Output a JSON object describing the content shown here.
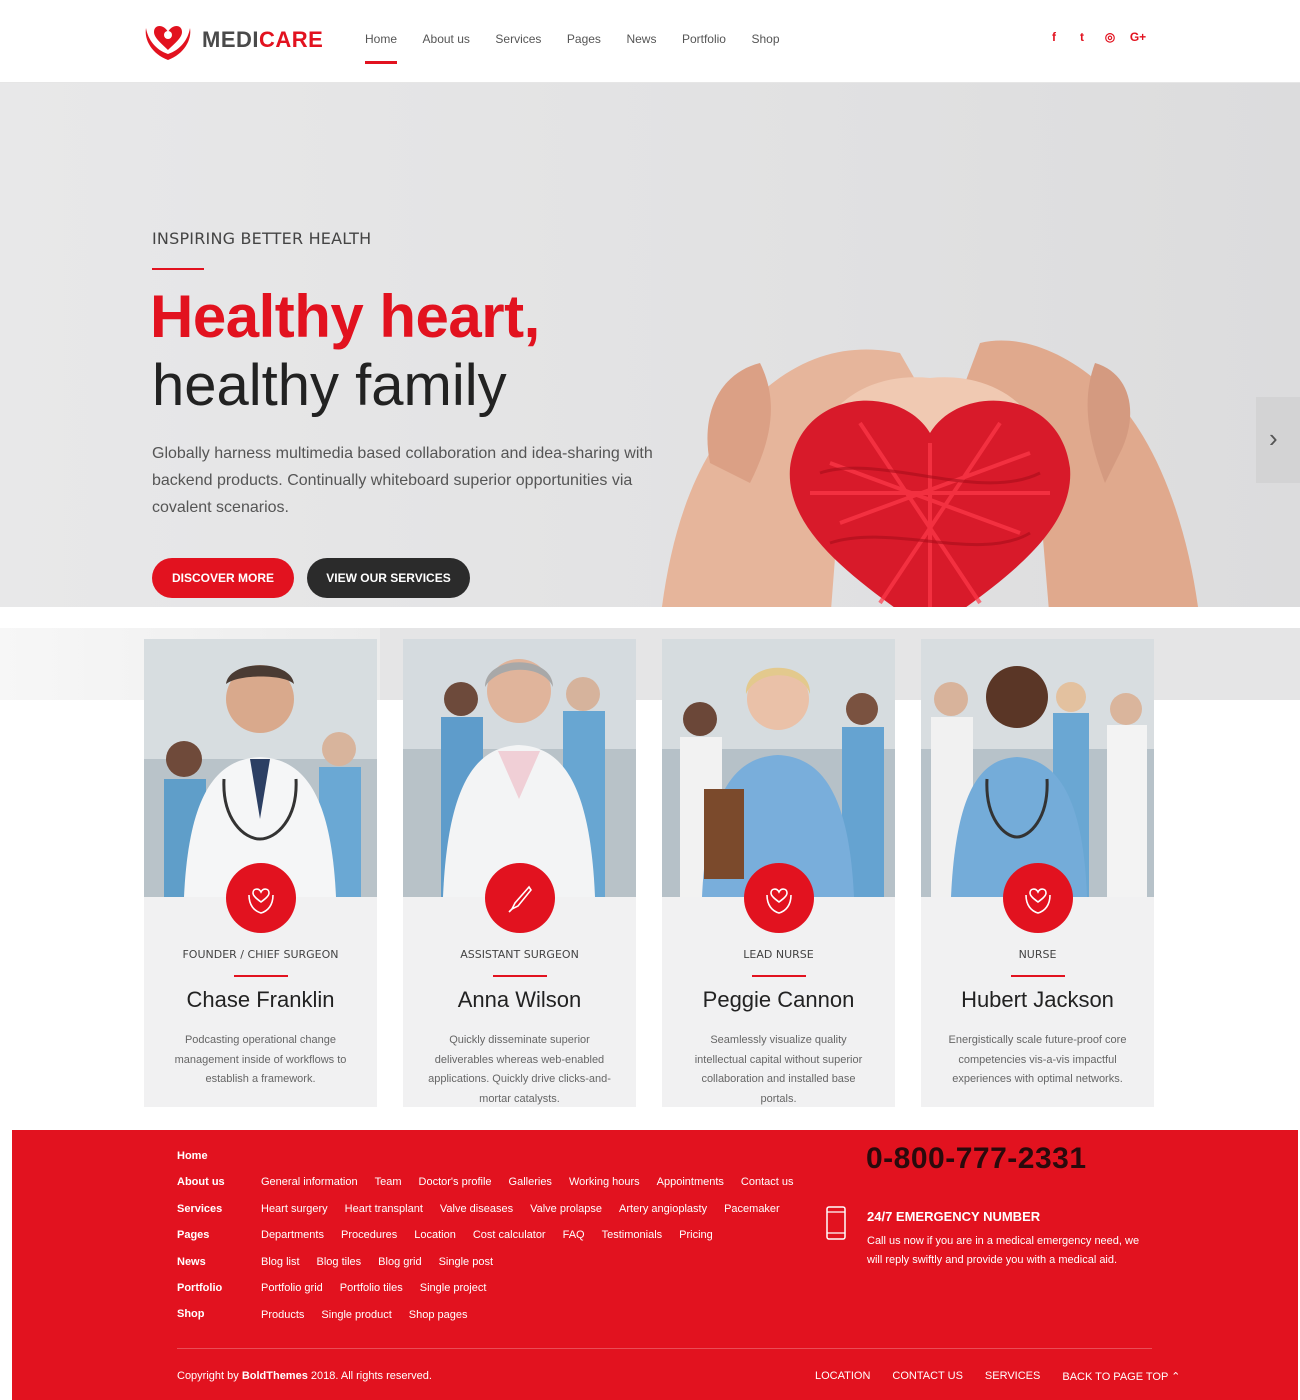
{
  "header": {
    "logo": {
      "part1": "MEDI",
      "part2": "CARE"
    },
    "nav": [
      "Home",
      "About us",
      "Services",
      "Pages",
      "News",
      "Portfolio",
      "Shop"
    ],
    "active_nav": "Home",
    "social": {
      "facebook": "f",
      "twitter": "t",
      "instagram": "◎",
      "google": "G+"
    }
  },
  "hero": {
    "kicker": "INSPIRING BETTER HEALTH",
    "title_line1": "Healthy heart,",
    "title_line2": "healthy family",
    "text": "Globally harness multimedia based collaboration and idea-sharing with backend products. Continually whiteboard superior opportunities via covalent scenarios.",
    "btn_primary": "DISCOVER MORE",
    "btn_secondary": "VIEW OUR SERVICES",
    "next_arrow": "›"
  },
  "team": [
    {
      "role": "FOUNDER / CHIEF SURGEON",
      "name": "Chase Franklin",
      "desc": "Podcasting operational change management inside of workflows to establish a framework.",
      "icon": "heart-hands-icon"
    },
    {
      "role": "ASSISTANT SURGEON",
      "name": "Anna Wilson",
      "desc": "Quickly disseminate superior deliverables whereas web-enabled applications. Quickly drive clicks-and-mortar catalysts.",
      "icon": "scalpel-icon"
    },
    {
      "role": "LEAD NURSE",
      "name": "Peggie Cannon",
      "desc": "Seamlessly visualize quality intellectual capital without superior collaboration and installed base portals.",
      "icon": "heart-hands-icon"
    },
    {
      "role": "NURSE",
      "name": "Hubert Jackson",
      "desc": "Energistically scale future-proof core competencies vis-a-vis impactful experiences with optimal networks.",
      "icon": "heart-hands-icon"
    }
  ],
  "footer": {
    "main_links": [
      "Home",
      "About us",
      "Services",
      "Pages",
      "News",
      "Portfolio",
      "Shop"
    ],
    "sub_links": [
      [
        "General information",
        "Team",
        "Doctor's profile",
        "Galleries",
        "Working hours",
        "Appointments",
        "Contact us"
      ],
      [
        "Heart surgery",
        "Heart transplant",
        "Valve diseases",
        "Valve prolapse",
        "Artery angioplasty",
        "Pacemaker"
      ],
      [
        "Departments",
        "Procedures",
        "Location",
        "Cost calculator",
        "FAQ",
        "Testimonials",
        "Pricing"
      ],
      [
        "Blog list",
        "Blog tiles",
        "Blog grid",
        "Single post"
      ],
      [
        "Portfolio grid",
        "Portfolio tiles",
        "Single project"
      ],
      [
        "Products",
        "Single product",
        "Shop pages"
      ]
    ],
    "phone": "0-800-777-2331",
    "emergency_title": "24/7 EMERGENCY NUMBER",
    "emergency_text": "Call us now if you are in a medical emergency need, we will reply swiftly and provide you with a medical aid.",
    "copyright_prefix": "Copyright by ",
    "copyright_brand": "BoldThemes",
    "copyright_suffix": " 2018. All rights reserved.",
    "bottom_links": [
      "LOCATION",
      "CONTACT US",
      "SERVICES",
      "BACK TO PAGE TOP ⌃"
    ]
  },
  "colors": {
    "accent": "#e2121f",
    "dark": "#2b2b2b",
    "text": "#555555"
  }
}
